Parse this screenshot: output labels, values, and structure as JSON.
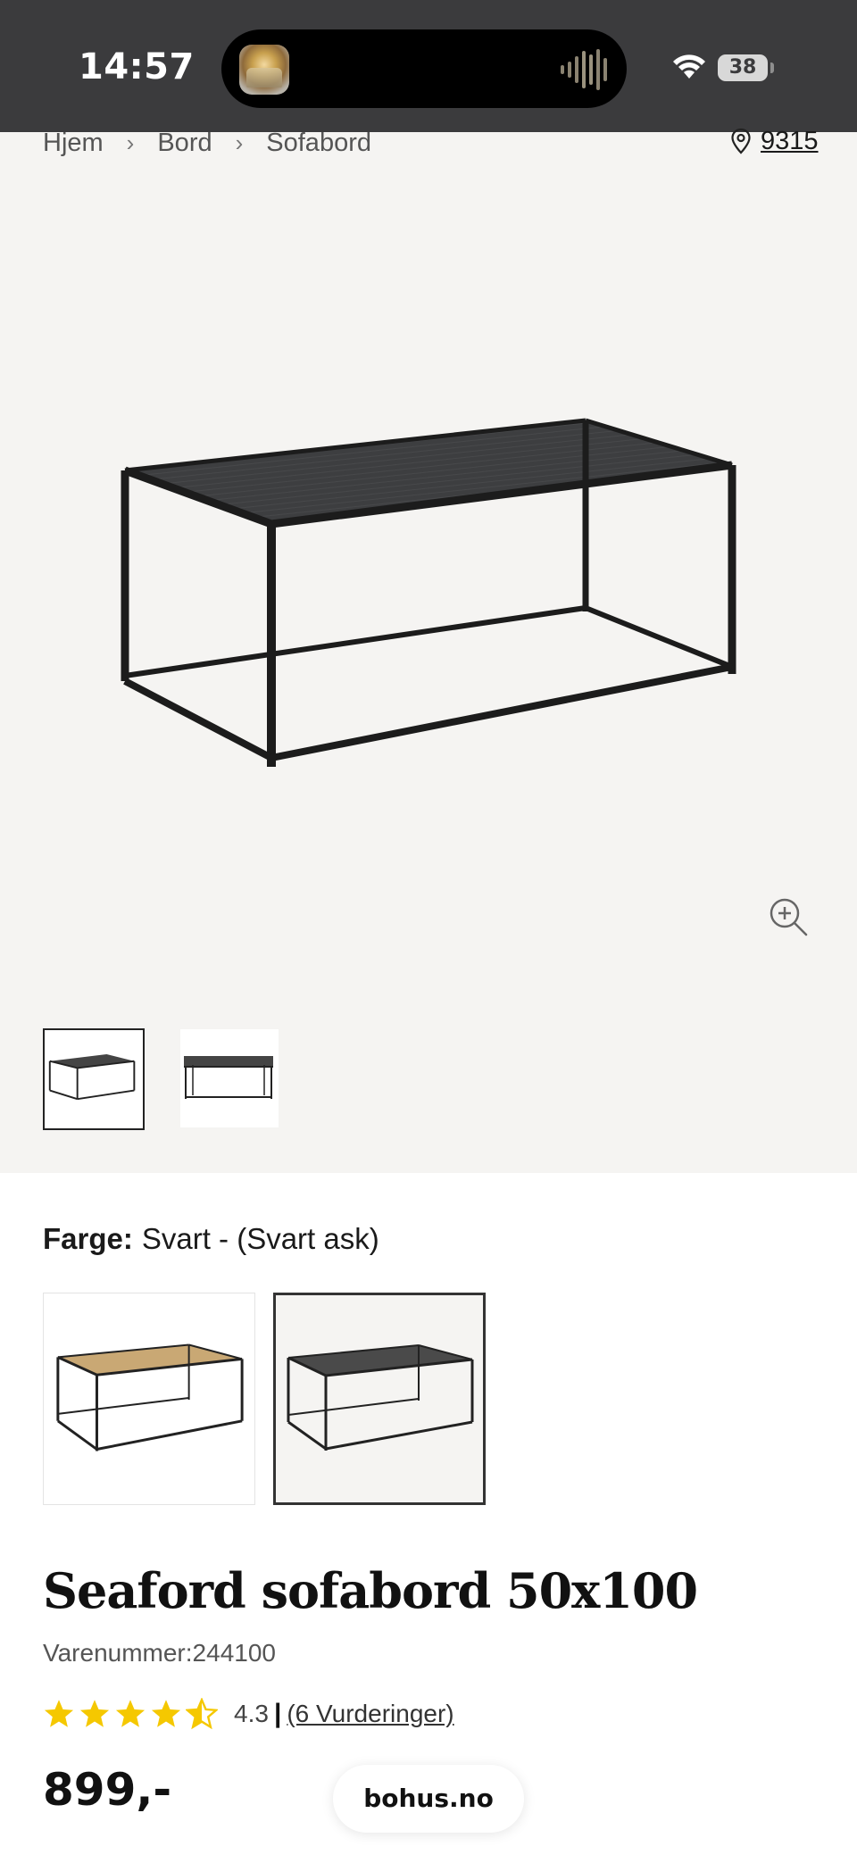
{
  "status_bar": {
    "time": "14:57",
    "battery": "38",
    "icons": [
      "live-activity-thumbnail",
      "audio-waveform-icon",
      "wifi-icon",
      "battery-icon"
    ]
  },
  "breadcrumb": {
    "items": [
      "Hjem",
      "Bord",
      "Sofabord"
    ],
    "separator": "›"
  },
  "store": {
    "label": "9315",
    "icon": "location-pin-icon"
  },
  "gallery": {
    "zoom_icon": "zoom-in-icon",
    "thumbnails": [
      "thumbnail-1",
      "thumbnail-2"
    ],
    "selected_thumbnail": 0
  },
  "color": {
    "key": "Farge:",
    "value": "Svart - (Svart ask)",
    "options": [
      {
        "name": "oak-table-swatch",
        "top_color": "#c9a874"
      },
      {
        "name": "black-table-swatch",
        "top_color": "#4a4a4a"
      }
    ],
    "selected": 1
  },
  "product": {
    "title": "Seaford sofabord 50x100",
    "sku_label": "Varenummer: ",
    "sku": "244100",
    "rating": "4.3",
    "rating_fraction": 0.86,
    "rating_separator": "|",
    "rating_count": "(6 Vurderinger)",
    "price": "899,-"
  },
  "footer": {
    "domain": "bohus.no"
  },
  "colors": {
    "status_bar_bg": "#3b3b3d",
    "gallery_bg": "#f5f4f2",
    "star": "#f5c800"
  }
}
